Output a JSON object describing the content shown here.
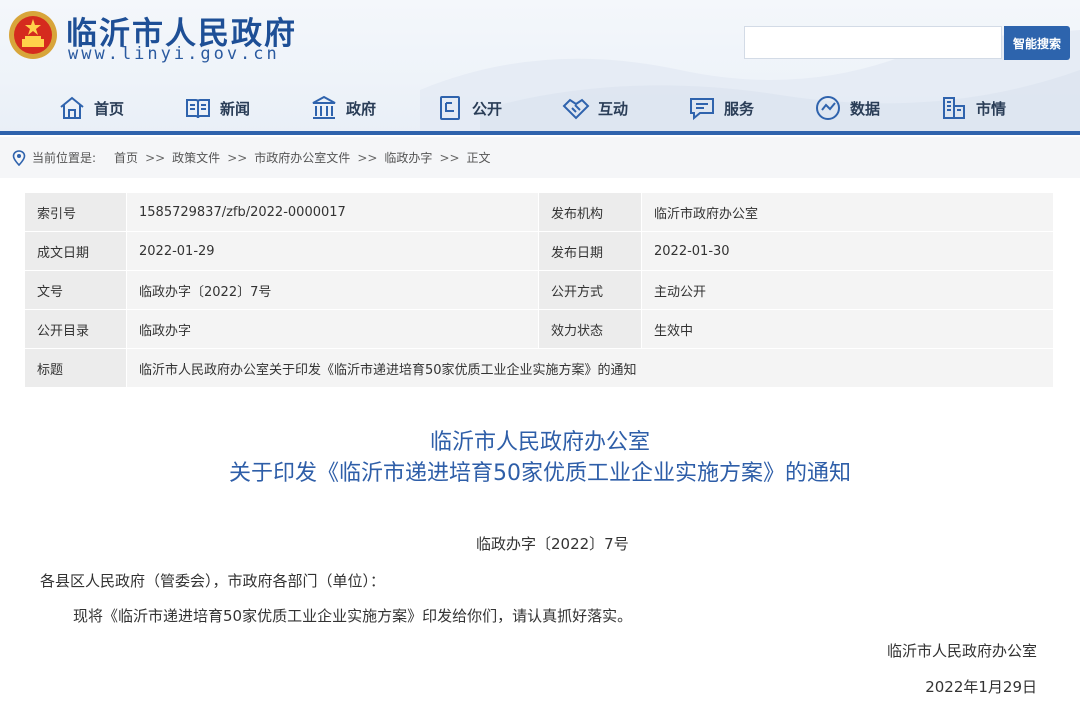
{
  "header": {
    "site_name": "临沂市人民政府",
    "site_domain": "www.linyi.gov.cn",
    "search_placeholder": "",
    "search_button": "智能搜索"
  },
  "nav": {
    "items": [
      {
        "label": "首页",
        "icon": "home-icon"
      },
      {
        "label": "新闻",
        "icon": "news-icon"
      },
      {
        "label": "政府",
        "icon": "government-building-icon"
      },
      {
        "label": "公开",
        "icon": "disclosure-icon"
      },
      {
        "label": "互动",
        "icon": "handshake-icon"
      },
      {
        "label": "服务",
        "icon": "service-chat-icon"
      },
      {
        "label": "数据",
        "icon": "data-globe-icon"
      },
      {
        "label": "市情",
        "icon": "city-building-icon"
      }
    ],
    "accent_color": "#2f63ad"
  },
  "breadcrumb": {
    "label": "当前位置是:",
    "items": [
      "首页",
      "政策文件",
      "市政府办公室文件",
      "临政办字",
      "正文"
    ],
    "separator": ">>"
  },
  "meta": {
    "rows": [
      [
        "索引号",
        "1585729837/zfb/2022-0000017",
        "发布机构",
        "临沂市政府办公室"
      ],
      [
        "成文日期",
        "2022-01-29",
        "发布日期",
        "2022-01-30"
      ],
      [
        "文号",
        "临政办字〔2022〕7号",
        "公开方式",
        "主动公开"
      ],
      [
        "公开目录",
        "临政办字",
        "效力状态",
        "生效中"
      ]
    ],
    "title_key": "标题",
    "title_value": "临沂市人民政府办公室关于印发《临沂市递进培育50家优质工业企业实施方案》的通知"
  },
  "document": {
    "title_line1": "临沂市人民政府办公室",
    "title_line2": "关于印发《临沂市递进培育50家优质工业企业实施方案》的通知",
    "number": "临政办字〔2022〕7号",
    "addressee": "各县区人民政府（管委会），市政府各部门（单位）：",
    "body": "现将《临沂市递进培育50家优质工业企业实施方案》印发给你们，请认真抓好落实。",
    "signature": "临沂市人民政府办公室",
    "date": "2022年1月29日"
  }
}
